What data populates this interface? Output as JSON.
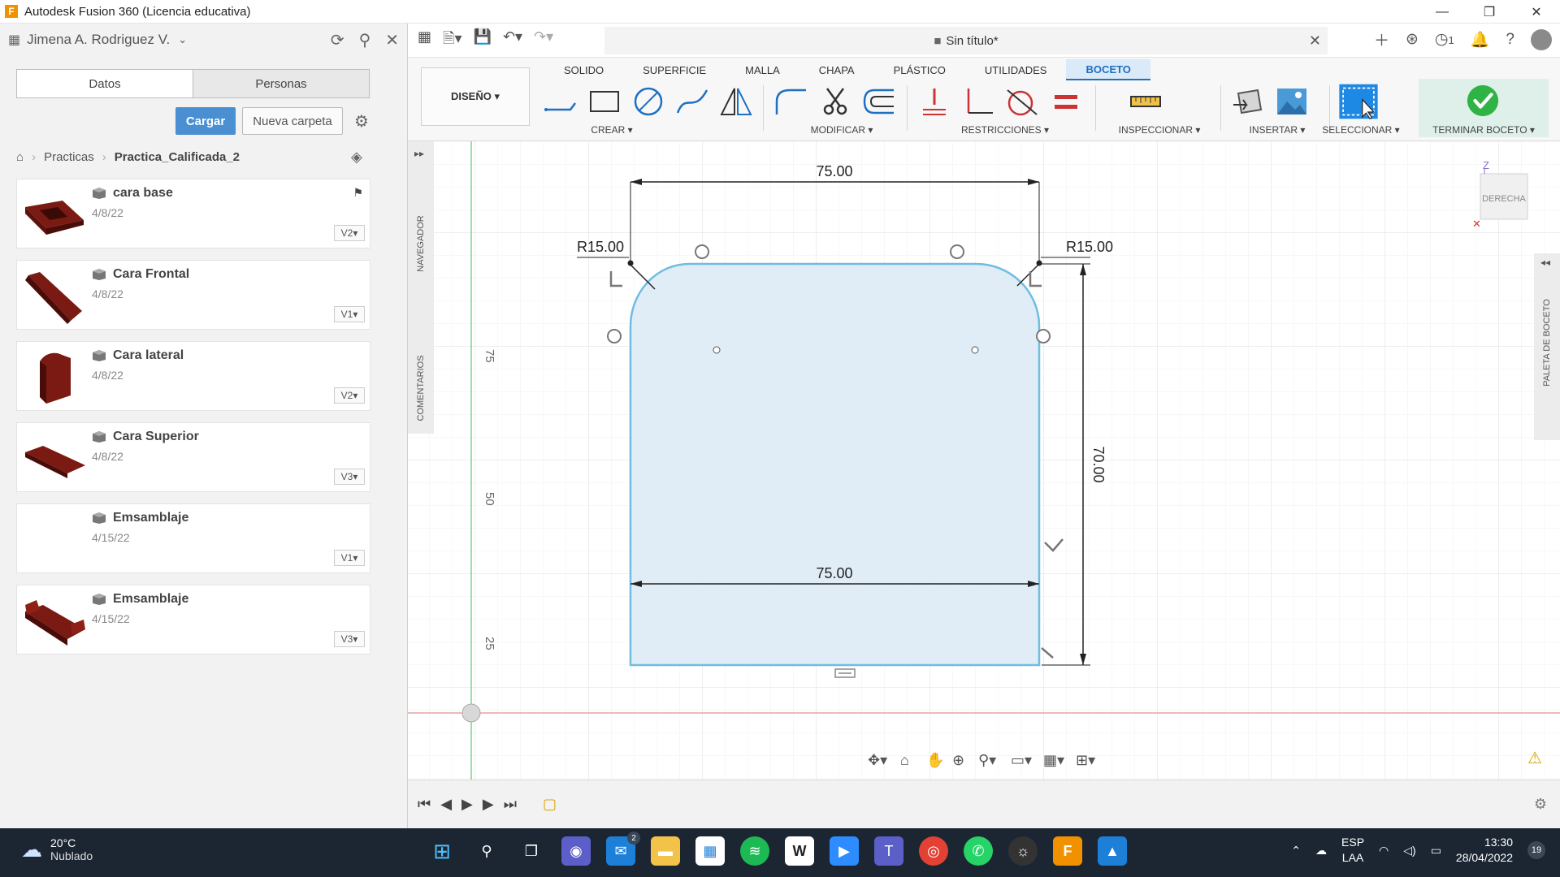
{
  "window": {
    "title": "Autodesk Fusion 360 (Licencia educativa)"
  },
  "data_panel": {
    "user": "Jimena A. Rodriguez V.",
    "tabs": [
      "Datos",
      "Personas"
    ],
    "upload_label": "Cargar",
    "new_folder_label": "Nueva carpeta",
    "breadcrumb": [
      "Practicas",
      "Practica_Calificada_2"
    ],
    "files": [
      {
        "name": "cara base",
        "date": "4/8/22",
        "version": "V2▾"
      },
      {
        "name": "Cara Frontal",
        "date": "4/8/22",
        "version": "V1▾"
      },
      {
        "name": "Cara lateral",
        "date": "4/8/22",
        "version": "V2▾"
      },
      {
        "name": "Cara Superior",
        "date": "4/8/22",
        "version": "V3▾"
      },
      {
        "name": "Emsamblaje",
        "date": "4/15/22",
        "version": "V1▾"
      },
      {
        "name": "Emsamblaje",
        "date": "4/15/22",
        "version": "V3▾"
      }
    ]
  },
  "document": {
    "tab_title": "Sin título*",
    "jobs_count": "1"
  },
  "toolbar": {
    "workspace": "DISEÑO ▾",
    "tabs": [
      "SOLIDO",
      "SUPERFICIE",
      "MALLA",
      "CHAPA",
      "PLÁSTICO",
      "UTILIDADES",
      "BOCETO"
    ],
    "groups": {
      "create": "CREAR ▾",
      "modify": "MODIFICAR ▾",
      "constraints": "RESTRICCIONES ▾",
      "inspect": "INSPECCIONAR ▾",
      "insert": "INSERTAR ▾",
      "select": "SELECCIONAR ▾",
      "finish": "TERMINAR BOCETO ▾"
    }
  },
  "canvas": {
    "navigator_label": "NAVEGADOR",
    "comments_label": "COMENTARIOS",
    "sketch_palette_label": "PALETA DE BOCETO",
    "viewcube_label": "DERECHA",
    "viewcube_axis": "Z",
    "ruler_labels": [
      "75",
      "50",
      "25"
    ],
    "dimensions": {
      "top_width": "75.00",
      "bottom_width": "75.00",
      "height": "70.00",
      "radius_left": "R15.00",
      "radius_right": "R15.00"
    }
  },
  "taskbar": {
    "weather_temp": "20°C",
    "weather_condition": "Nublado",
    "mail_badge": "2",
    "language_top": "ESP",
    "language_bottom": "LAA",
    "time": "13:30",
    "date": "28/04/2022",
    "notifications": "19"
  }
}
